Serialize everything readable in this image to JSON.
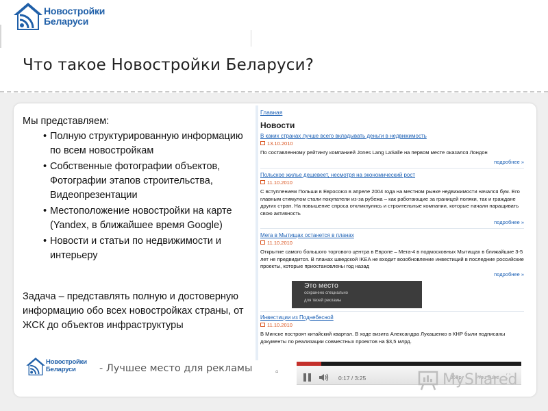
{
  "logo": {
    "line1": "Новостройки",
    "line2": "Беларуси"
  },
  "title": "Что такое Новостройки Беларуси?",
  "intro": "Мы представляем:",
  "bullets": [
    "Полную структурированную информацию по всем новостройкам",
    "Собственные фотографии объектов, Фотографии этапов строительства, Видеопрезентации",
    "Местоположение новостройки на карте (Yandex, в ближайшее время Google)",
    "Новости и статьи по недвижимости и интерьеру"
  ],
  "task": "Задача – представлять полную и достоверную информацию обо всех новостройках страны, от ЖСК до объектов инфраструктуры",
  "screenshot": {
    "breadcrumb": "Главная",
    "heading": "Новости",
    "more_label": "подробнее »",
    "news": [
      {
        "title": "В каких странах лучше всего вкладывать деньги в недвижимость",
        "date": "13.10.2010",
        "text": "По составленному рейтингу компанией Jones Lang LaSalle на первом месте оказался Лондон"
      },
      {
        "title": "Польское жилье дешевеет, несмотря на экономический рост",
        "date": "11.10.2010",
        "text": "С вступлением Польши в Евросоюз в апреле 2004 года на местном рынке недвижимости начался бум. Его главным стимулом стали покупатели из-за рубежа – как работающие за границей поляки, так и граждане других стран. На повышение спроса откликнулись и строительные компании, которые начали наращивать свою активность"
      },
      {
        "title": "Мега в Мытищах останется в планах",
        "date": "11.10.2010",
        "text": "Открытие самого большого торгового центра в Европе – Мега-4 в подмосковных Мытищах в ближайшие 3-5 лет не предвидится. В планах шведской IKEA не входит возобновление инвестиций в последние российские проекты, которые приостановлены год назад"
      },
      {
        "title": "Инвестиции из Поднебесной",
        "date": "11.10.2010",
        "text": "В Минске построят китайский квартал. В ходе визита Александра Лукашенко в КНР были подписаны документы по реализации совместных проектов на $3,5 млрд."
      }
    ],
    "ad": {
      "line1": "Это место",
      "line2": "сохранено специально",
      "line3": "для твоей рекламы"
    }
  },
  "slogan": "- Лучшее место для рекламы",
  "player": {
    "time": "0:17 / 3:25",
    "quality": "360p",
    "youtube": "You Tube"
  },
  "watermark": "MyShared",
  "colors": {
    "brand_blue": "#1f5fa8",
    "link_blue": "#1a5fb4",
    "date_orange": "#d9531e",
    "player_red": "#c4302b"
  }
}
